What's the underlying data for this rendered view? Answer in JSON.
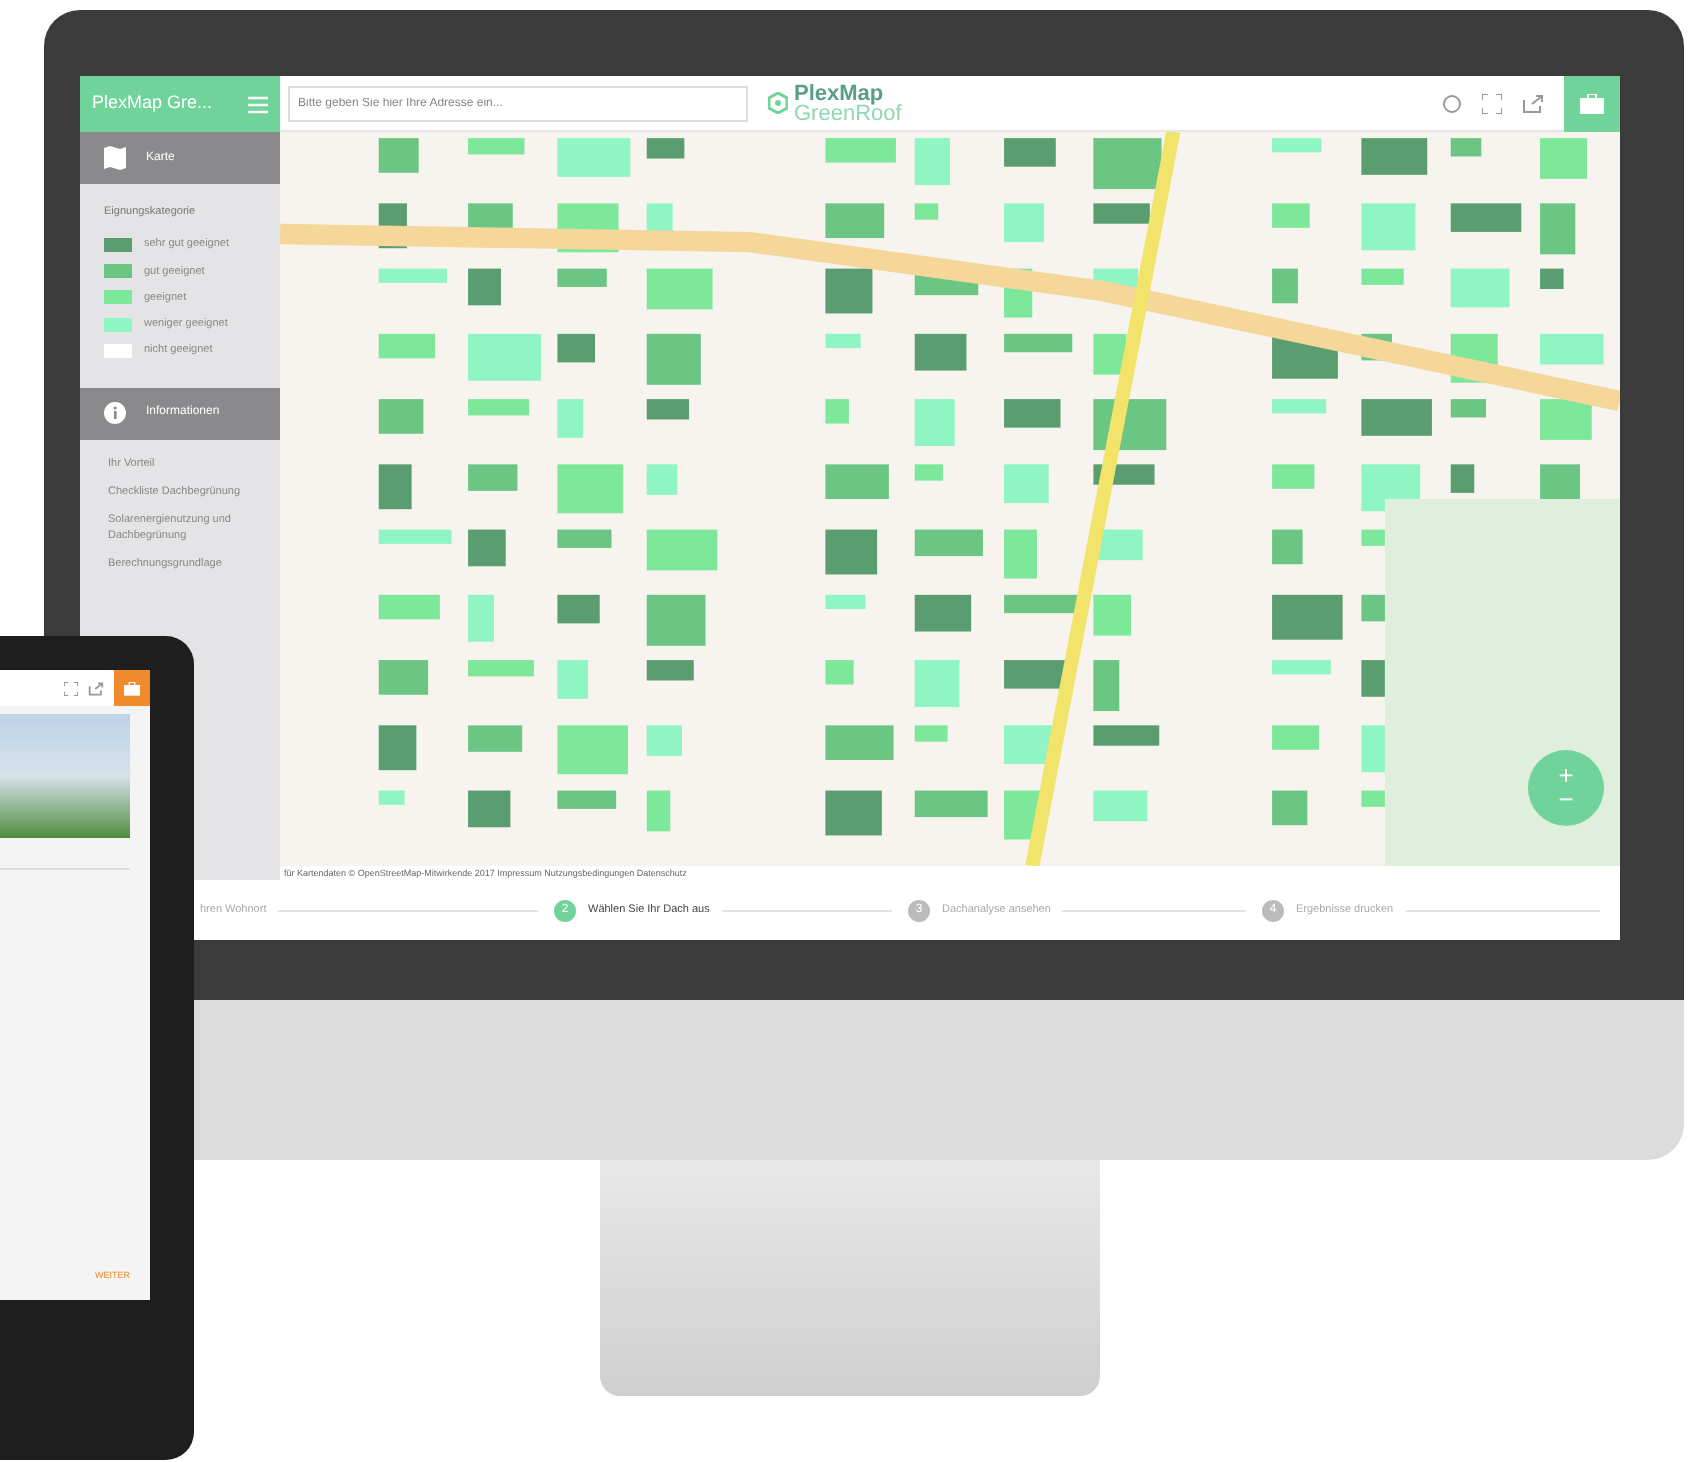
{
  "app": {
    "title": "PlexMap Gre...",
    "search": {
      "placeholder": "Bitte geben Sie hier Ihre Adresse ein..."
    },
    "logo": {
      "name": "PlexMap",
      "product": "GreenRoof"
    }
  },
  "sidebar": {
    "map_section": {
      "title": "Karte"
    },
    "legend_title": "Eignungskategorie",
    "legend": [
      {
        "label": "sehr gut geeignet",
        "color": "#5a9e70"
      },
      {
        "label": "gut geeignet",
        "color": "#6cc683"
      },
      {
        "label": "geeignet",
        "color": "#7ee89a"
      },
      {
        "label": "weniger geeignet",
        "color": "#8ff5c3"
      },
      {
        "label": "nicht geeignet",
        "color": "#ffffff"
      }
    ],
    "info_section": {
      "title": "Informationen"
    },
    "links": [
      "Ihr Vorteil",
      "Checkliste Dachbegrünung",
      "Solarenergienutzung und Dachbegrünung",
      "Berechnungsgrundlage"
    ]
  },
  "map": {
    "zoom_in": "+",
    "zoom_out": "−",
    "attribution": "für Kartendaten © OpenStreetMap-Mitwirkende 2017 Impressum Nutzungsbedingungen Datenschutz"
  },
  "steps": [
    {
      "label": "hren Wohnort",
      "selected": false
    },
    {
      "number": "2",
      "label": "Wählen Sie Ihr Dach aus",
      "selected": true
    },
    {
      "number": "3",
      "label": "Dachanalyse ansehen",
      "selected": false
    },
    {
      "number": "4",
      "label": "Ergebnisse drucken",
      "selected": false
    }
  ],
  "tablet": {
    "next_button": "WEITER"
  }
}
